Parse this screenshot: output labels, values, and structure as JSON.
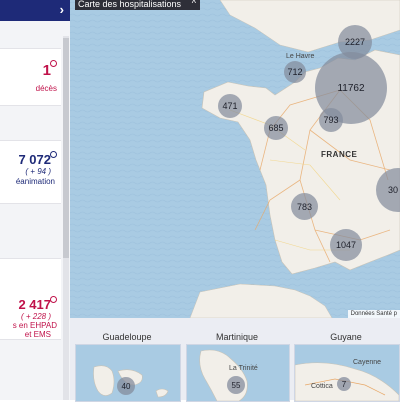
{
  "sidebar": {
    "chevron_icon": "chevron-right-icon",
    "cards": [
      {
        "value": "1",
        "label": "décès"
      },
      {
        "value": "7 072",
        "delta": "( + 94 )",
        "label": "éanimation"
      },
      {
        "value": "2 417",
        "delta": "( + 228 )",
        "label_line1": "s en EHPAD",
        "label_line2": "et EMS"
      }
    ]
  },
  "map": {
    "title": "Carte des hospitalisations",
    "caret_icon": "chevron-up-icon",
    "country_label": "FRANCE",
    "city_label": "Le Havre",
    "credit": "Données Santé p",
    "bubbles": [
      {
        "value": "2227"
      },
      {
        "value": "712"
      },
      {
        "value": "11762"
      },
      {
        "value": "471"
      },
      {
        "value": "793"
      },
      {
        "value": "685"
      },
      {
        "value": "30"
      },
      {
        "value": "783"
      },
      {
        "value": "1047"
      }
    ]
  },
  "overseas": [
    {
      "title": "Guadeloupe",
      "value": "40"
    },
    {
      "title": "Martinique",
      "value": "55",
      "place": "La Trinité"
    },
    {
      "title": "Guyane",
      "value": "7",
      "place1": "Cayenne",
      "place2": "Cottica"
    }
  ],
  "colors": {
    "accent": "#c0124a",
    "navy": "#1e2a78",
    "sea": "#a9cbe3",
    "land": "#f2efe9",
    "bubble": "#848c9c"
  }
}
